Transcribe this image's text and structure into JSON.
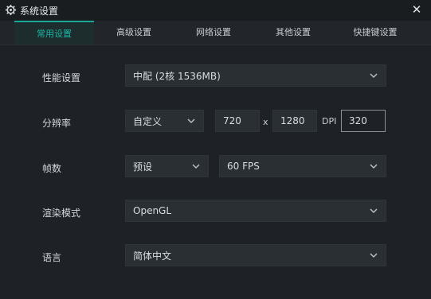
{
  "window": {
    "title": "系统设置",
    "close_glyph": "✕"
  },
  "tabs": [
    {
      "label": "常用设置",
      "active": true
    },
    {
      "label": "高级设置",
      "active": false
    },
    {
      "label": "网络设置",
      "active": false
    },
    {
      "label": "其他设置",
      "active": false
    },
    {
      "label": "快捷键设置",
      "active": false
    }
  ],
  "settings": {
    "performance": {
      "label": "性能设置",
      "value": "中配 (2核 1536MB)"
    },
    "resolution": {
      "label": "分辨率",
      "mode": "自定义",
      "width": "720",
      "x_sep": "x",
      "height": "1280",
      "dpi_label": "DPI",
      "dpi": "320"
    },
    "fps": {
      "label": "帧数",
      "mode": "预设",
      "value": "60 FPS"
    },
    "render": {
      "label": "渲染模式",
      "value": "OpenGL"
    },
    "language": {
      "label": "语言",
      "value": "简体中文"
    }
  },
  "colors": {
    "accent": "#1ab6a6",
    "bg": "#1f2327",
    "field": "#2a2f34"
  },
  "icons": {
    "title": "gear-icon",
    "close": "close-icon",
    "dropdown": "chevron-down-icon"
  }
}
